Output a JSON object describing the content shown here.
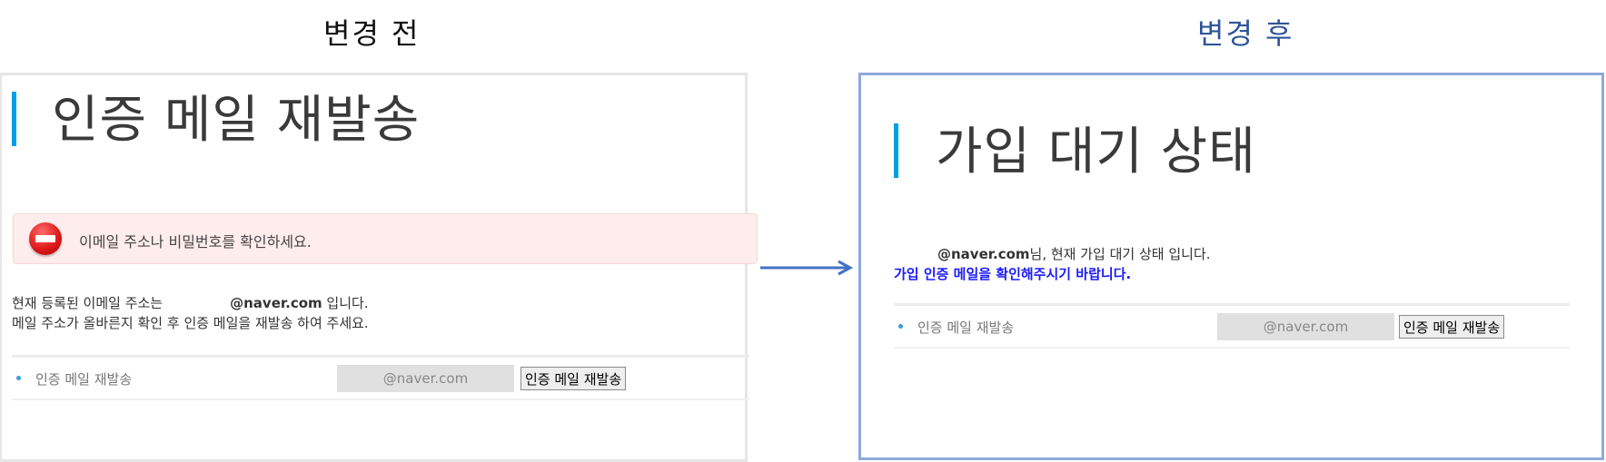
{
  "captions": {
    "before": "변경 전",
    "after": "변경 후"
  },
  "colors": {
    "accent_bar": "#00a0e9",
    "after_caption": "#2f5597",
    "after_border": "#8ea9db",
    "arrow": "#4472c4",
    "notice_blue": "#1a1aff",
    "alert_bg": "#ffecec"
  },
  "before": {
    "title": "인증 메일 재발송",
    "alert": {
      "icon": "error-stop-icon",
      "message": "이메일 주소나 비밀번호를 확인하세요."
    },
    "info": {
      "line1_prefix": "현재 등록된 이메일 주소는",
      "email": "@naver.com",
      "line1_suffix": " 입니다.",
      "line2": "메일 주소가 올바른지 확인 후 인증 메일을 재발송 하여 주세요."
    },
    "resend_row": {
      "label": "인증 메일 재발송",
      "email_value": "@naver.com",
      "button_label": "인증 메일 재발송"
    }
  },
  "after": {
    "title": "가입 대기 상태",
    "info": {
      "email": "@naver.com",
      "line1_suffix": "님, 현재 가입 대기 상태 입니다.",
      "line2": "가입 인증 메일을 확인해주시기 바랍니다."
    },
    "resend_row": {
      "label": "인증 메일 재발송",
      "email_value": "@naver.com",
      "button_label": "인증 메일 재발송"
    }
  },
  "arrow": {
    "icon": "right-arrow-icon"
  }
}
